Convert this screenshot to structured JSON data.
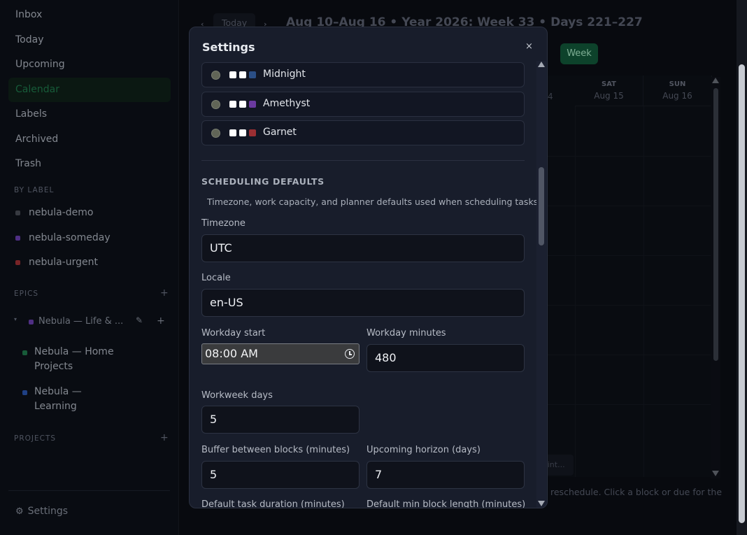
{
  "sidebar": {
    "nav": [
      {
        "label": "Inbox"
      },
      {
        "label": "Today"
      },
      {
        "label": "Upcoming"
      },
      {
        "label": "Calendar"
      },
      {
        "label": "Labels"
      },
      {
        "label": "Archived"
      },
      {
        "label": "Trash"
      }
    ],
    "by_label_heading": "BY LABEL",
    "labels": [
      {
        "name": "nebula-demo",
        "color": "#4a4e57"
      },
      {
        "name": "nebula-someday",
        "color": "#6a3fb0"
      },
      {
        "name": "nebula-urgent",
        "color": "#a03034"
      }
    ],
    "epics_heading": "EPICS",
    "epic": {
      "name": "Nebula — Life & ...",
      "color": "#6a3fb0"
    },
    "projects_in_epic": [
      {
        "name": "Nebula — Home Projects",
        "color": "#1f7a4c"
      },
      {
        "name": "Nebula — Learning",
        "color": "#2a56b0"
      }
    ],
    "projects_heading": "PROJECTS",
    "settings_label": "Settings"
  },
  "calendar": {
    "today_label": "Today",
    "title": "Aug 10–Aug 16 • Year 2026: Week 33 • Days 221–227",
    "week_button": "Week",
    "partial_day": "4",
    "days": [
      {
        "name": "SAT",
        "date": "Aug 15"
      },
      {
        "name": "SUN",
        "date": "Aug 16"
      }
    ],
    "ghost_chip": "oint...",
    "hint": "reschedule. Click a block or due for the"
  },
  "settings": {
    "title": "Settings",
    "close": "×",
    "themes": [
      {
        "name": "Midnight",
        "swatches": [
          "#ffffff",
          "#ffffff",
          "#2b4f86"
        ]
      },
      {
        "name": "Amethyst",
        "swatches": [
          "#ffffff",
          "#ffffff",
          "#6b3aa0"
        ]
      },
      {
        "name": "Garnet",
        "swatches": [
          "#ffffff",
          "#ffffff",
          "#9b2f33"
        ]
      }
    ],
    "section_heading": "SCHEDULING DEFAULTS",
    "section_desc": "Timezone, work capacity, and planner defaults used when scheduling tasks.",
    "fields": {
      "timezone": {
        "label": "Timezone",
        "value": "UTC"
      },
      "locale": {
        "label": "Locale",
        "value": "en-US"
      },
      "workday_start": {
        "label": "Workday start",
        "value": "08:00 AM"
      },
      "workday_minutes": {
        "label": "Workday minutes",
        "value": "480"
      },
      "workweek_days": {
        "label": "Workweek days",
        "value": "5"
      },
      "buffer": {
        "label": "Buffer between blocks (minutes)",
        "value": "5"
      },
      "horizon": {
        "label": "Upcoming horizon (days)",
        "value": "7"
      },
      "task_duration": {
        "label": "Default task duration (minutes)"
      },
      "min_block": {
        "label": "Default min block length (minutes)"
      }
    }
  }
}
